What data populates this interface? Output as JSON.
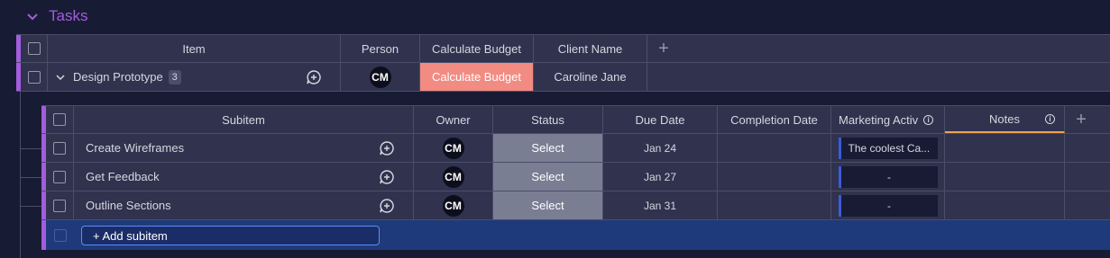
{
  "group": {
    "title": "Tasks",
    "color": "#a25ddc"
  },
  "main_table": {
    "columns": [
      "Item",
      "Person",
      "Calculate Budget",
      "Client Name"
    ],
    "add_column": "+",
    "item": {
      "name": "Design Prototype",
      "subitem_count": "3",
      "person": "CM",
      "budget_button": "Calculate Budget",
      "client_name": "Caroline Jane"
    }
  },
  "sub_table": {
    "columns": [
      "Subitem",
      "Owner",
      "Status",
      "Due Date",
      "Completion Date",
      "Marketing Activ",
      "Notes"
    ],
    "add_column": "+",
    "rows": [
      {
        "name": "Create Wireframes",
        "owner": "CM",
        "status": "Select",
        "due": "Jan 24",
        "completion": "",
        "marketing": "The coolest Ca...",
        "notes": ""
      },
      {
        "name": "Get Feedback",
        "owner": "CM",
        "status": "Select",
        "due": "Jan 27",
        "completion": "",
        "marketing": "-",
        "notes": ""
      },
      {
        "name": "Outline Sections",
        "owner": "CM",
        "status": "Select",
        "due": "Jan 31",
        "completion": "",
        "marketing": "-",
        "notes": ""
      }
    ],
    "add_subitem": "+ Add subitem"
  },
  "colors": {
    "background": "#181b34",
    "row": "#30324e",
    "accent": "#a25ddc",
    "budget_button": "#f28b82",
    "status_select": "#797e93",
    "add_row": "#1f3a7a",
    "marketing_bar": "#3b5cd9",
    "notes_underline": "#f3a14f"
  }
}
